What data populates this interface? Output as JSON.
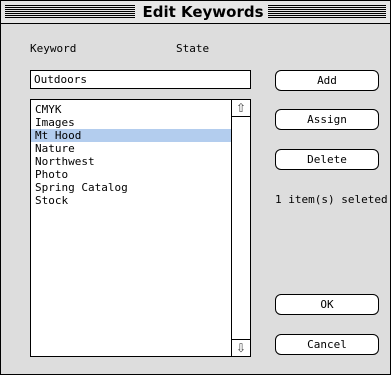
{
  "window": {
    "title": "Edit Keywords"
  },
  "columns": {
    "keyword": "Keyword",
    "state": "State"
  },
  "keyword_field": {
    "value": "Outdoors"
  },
  "keywords": [
    {
      "label": "CMYK",
      "selected": false
    },
    {
      "label": "Images",
      "selected": false
    },
    {
      "label": "Mt Hood",
      "selected": true
    },
    {
      "label": "Nature",
      "selected": false
    },
    {
      "label": "Northwest",
      "selected": false
    },
    {
      "label": "Photo",
      "selected": false
    },
    {
      "label": "Spring Catalog",
      "selected": false
    },
    {
      "label": "Stock",
      "selected": false
    }
  ],
  "buttons": {
    "add": "Add",
    "assign": "Assign",
    "delete": "Delete",
    "ok": "OK",
    "cancel": "Cancel"
  },
  "status_text": "1 item(s) seleted",
  "colors": {
    "selection": "#b3cdee",
    "dialog_bg": "#dddddd"
  }
}
